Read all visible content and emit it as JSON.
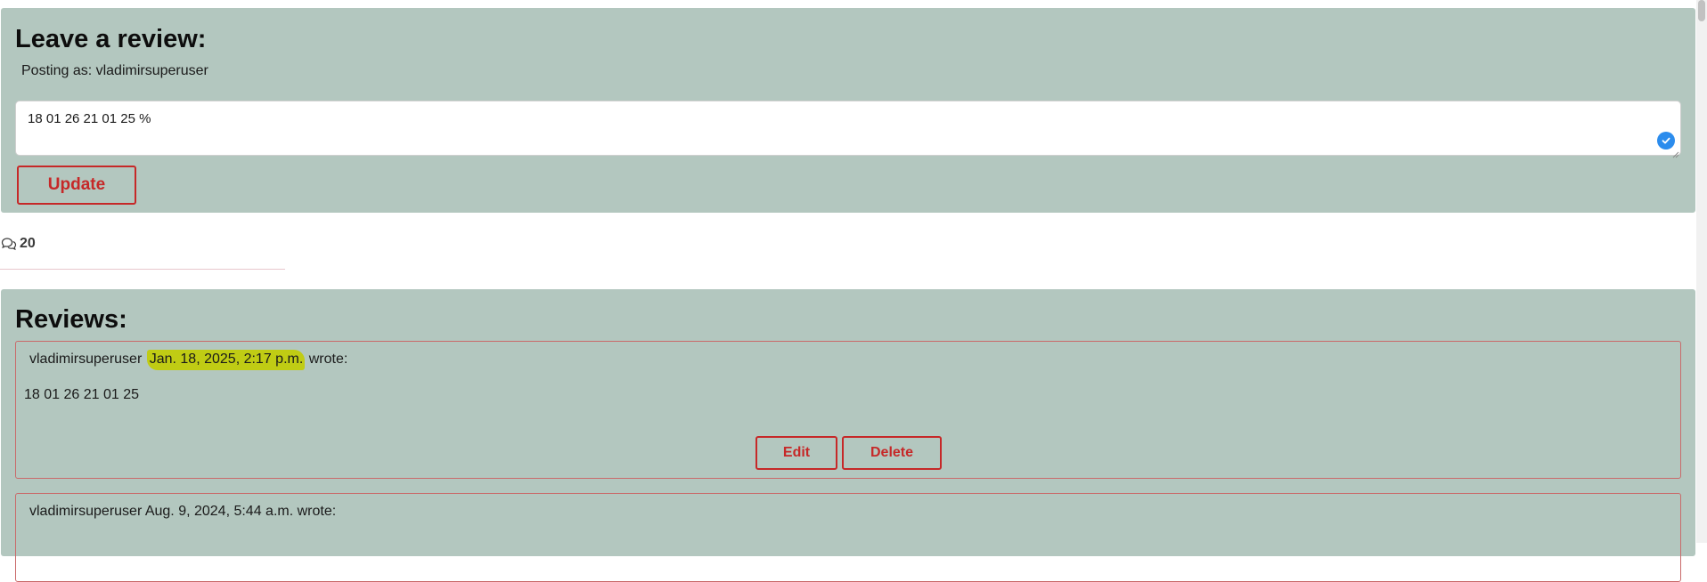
{
  "review_form": {
    "title": "Leave a review:",
    "posting_as": "Posting as: vladimirsuperuser",
    "textarea_value": "18 01 26 21 01 25 %",
    "update_label": "Update"
  },
  "comment_count": "20",
  "reviews_section": {
    "title": "Reviews:",
    "items": [
      {
        "author": "vladimirsuperuser",
        "date": "Jan. 18, 2025, 2:17 p.m.",
        "wrote": "wrote:",
        "body": "18 01 26 21 01 25",
        "edit_label": "Edit",
        "delete_label": "Delete"
      },
      {
        "author": "vladimirsuperuser",
        "date": "Aug. 9, 2024, 5:44 a.m.",
        "wrote": "wrote:"
      }
    ]
  },
  "colors": {
    "panel_bg": "#b3c7bf",
    "accent_red": "#c62828",
    "highlight": "#c0cc14",
    "check_blue": "#2b8ced"
  },
  "icons": {
    "comment": "comments-icon",
    "grammar": "grammar-check-icon"
  }
}
